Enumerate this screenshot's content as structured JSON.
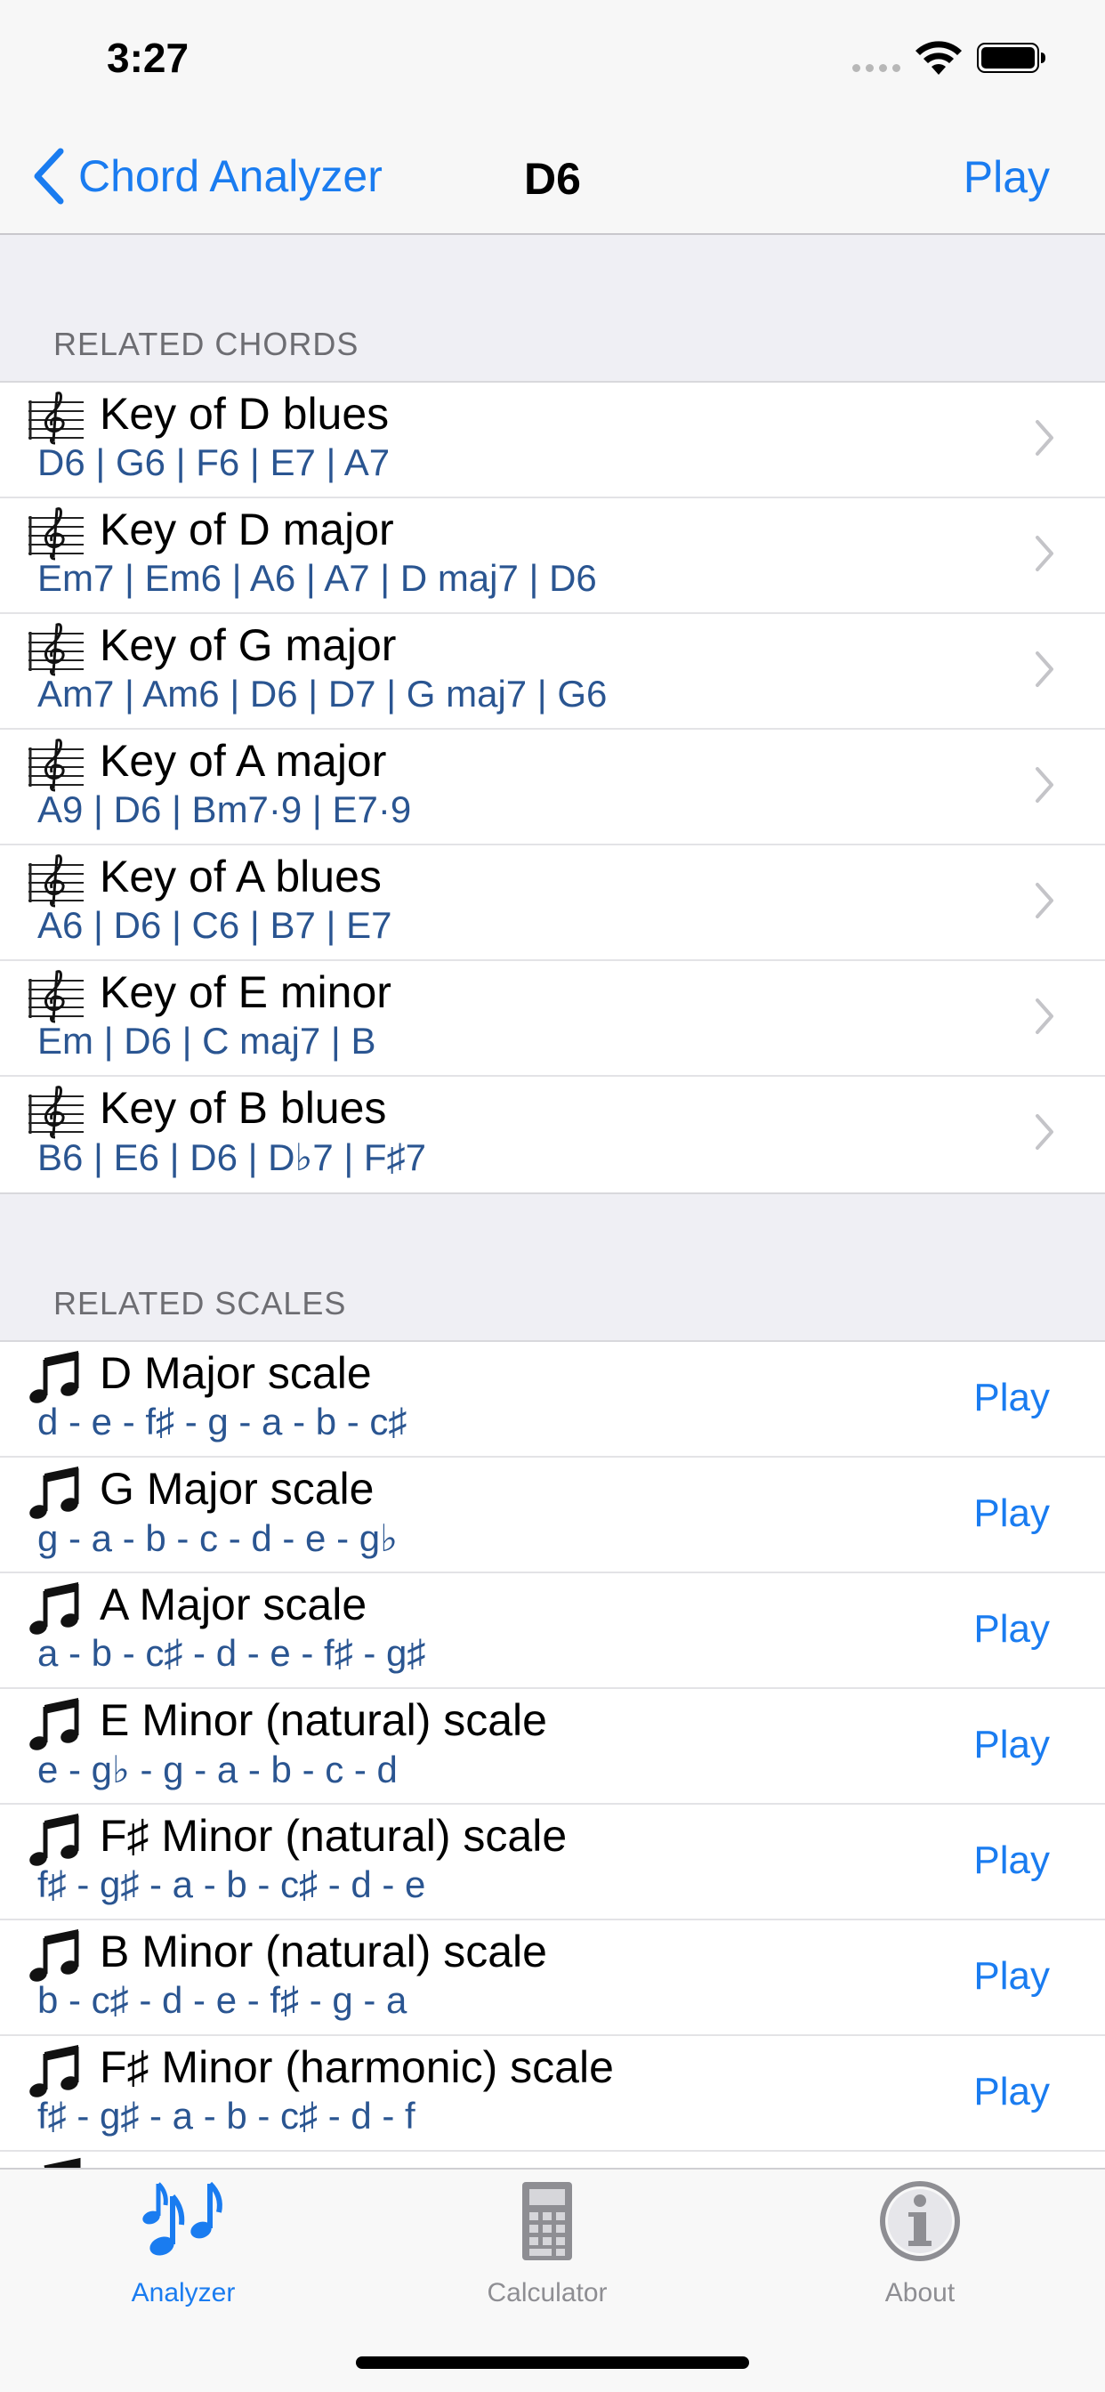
{
  "status_bar": {
    "time": "3:27"
  },
  "nav": {
    "back_label": "Chord Analyzer",
    "title": "D6",
    "play_label": "Play"
  },
  "related_chords": {
    "header": "RELATED CHORDS",
    "icon": "treble-clef-staff-icon",
    "items": [
      {
        "title": "Key of D blues",
        "chords": "D6 | G6 | F6 | E7 | A7"
      },
      {
        "title": "Key of D major",
        "chords": "Em7 | Em6 | A6 | A7 | D maj7 | D6"
      },
      {
        "title": "Key of G major",
        "chords": "Am7 | Am6 | D6 | D7 | G maj7 | G6"
      },
      {
        "title": "Key of A major",
        "chords": "A9 | D6 | Bm7·9 | E7·9"
      },
      {
        "title": "Key of A blues",
        "chords": "A6 | D6 | C6 | B7 | E7"
      },
      {
        "title": "Key of E minor",
        "chords": "Em | D6 | C maj7 | B"
      },
      {
        "title": "Key of B blues",
        "chords": "B6 | E6 | D6 | D♭7 | F♯7"
      }
    ]
  },
  "related_scales": {
    "header": "RELATED SCALES",
    "icon": "music-note-icon",
    "play_label": "Play",
    "items": [
      {
        "title": "D Major scale",
        "notes": "d - e - f♯ - g - a - b - c♯"
      },
      {
        "title": "G Major scale",
        "notes": "g - a - b - c - d - e - g♭"
      },
      {
        "title": "A Major scale",
        "notes": "a - b - c♯ - d - e - f♯ - g♯"
      },
      {
        "title": "E Minor (natural) scale",
        "notes": "e - g♭ - g - a - b - c - d"
      },
      {
        "title": "F♯ Minor (natural) scale",
        "notes": "f♯ - g♯ - a - b - c♯ - d - e"
      },
      {
        "title": "B Minor (natural) scale",
        "notes": "b - c♯ - d - e - f♯ - g - a"
      },
      {
        "title": "F♯ Minor (harmonic) scale",
        "notes": "f♯ - g♯ - a - b - c♯ - d - f"
      }
    ]
  },
  "tab_bar": {
    "tabs": [
      {
        "label": "Analyzer",
        "icon": "music-notes-icon",
        "active": true
      },
      {
        "label": "Calculator",
        "icon": "calculator-icon",
        "active": false
      },
      {
        "label": "About",
        "icon": "info-icon",
        "active": false
      }
    ]
  },
  "colors": {
    "accent": "#1a7cf0",
    "subtitle": "#2a5591",
    "background": "#efeff4",
    "header_text": "#6d6d72"
  }
}
